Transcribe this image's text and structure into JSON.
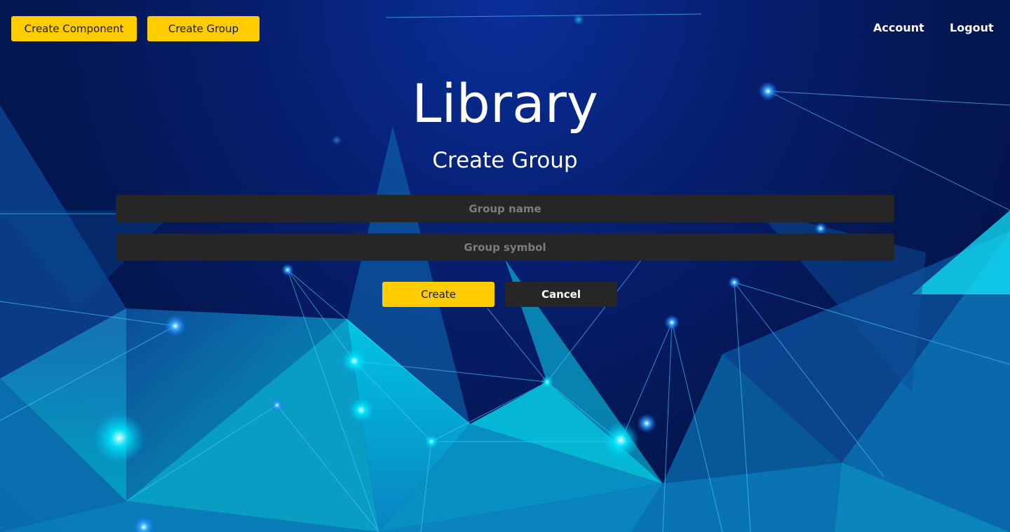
{
  "nav": {
    "create_component_label": "Create Component",
    "create_group_label": "Create Group",
    "account_label": "Account",
    "logout_label": "Logout"
  },
  "page": {
    "title": "Library",
    "subtitle": "Create Group"
  },
  "form": {
    "group_name": {
      "value": "",
      "placeholder": "Group name"
    },
    "group_symbol": {
      "value": "",
      "placeholder": "Group symbol"
    },
    "create_label": "Create",
    "cancel_label": "Cancel"
  },
  "colors": {
    "accent": "#ffcc00",
    "dark_button": "#262626",
    "background_deep": "#041650",
    "background_glow": "#00e5ff"
  }
}
